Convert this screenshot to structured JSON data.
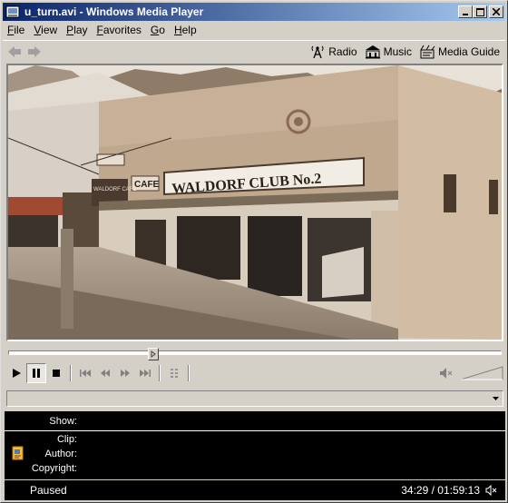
{
  "window": {
    "title": "u_turn.avi - Windows Media Player"
  },
  "menu": [
    {
      "first": "F",
      "rest": "ile"
    },
    {
      "first": "V",
      "rest": "iew"
    },
    {
      "first": "P",
      "rest": "lay"
    },
    {
      "first": "F",
      "rest": "avorites"
    },
    {
      "first": "G",
      "rest": "o"
    },
    {
      "first": "H",
      "rest": "elp"
    }
  ],
  "nav": {
    "radio": "Radio",
    "music": "Music",
    "guide": "Media Guide"
  },
  "video": {
    "sign_text": "WALDORF CLUB No.2",
    "cafe_text": "CAFE",
    "small_sign": "WALDORF CAFE"
  },
  "seek": {
    "position": 0.29
  },
  "volume": {
    "level": 0.0
  },
  "info": {
    "show_label": "Show:",
    "clip_label": "Clip:",
    "author_label": "Author:",
    "copyright_label": "Copyright:"
  },
  "status": {
    "state": "Paused",
    "time": "34:29 / 01:59:13"
  }
}
